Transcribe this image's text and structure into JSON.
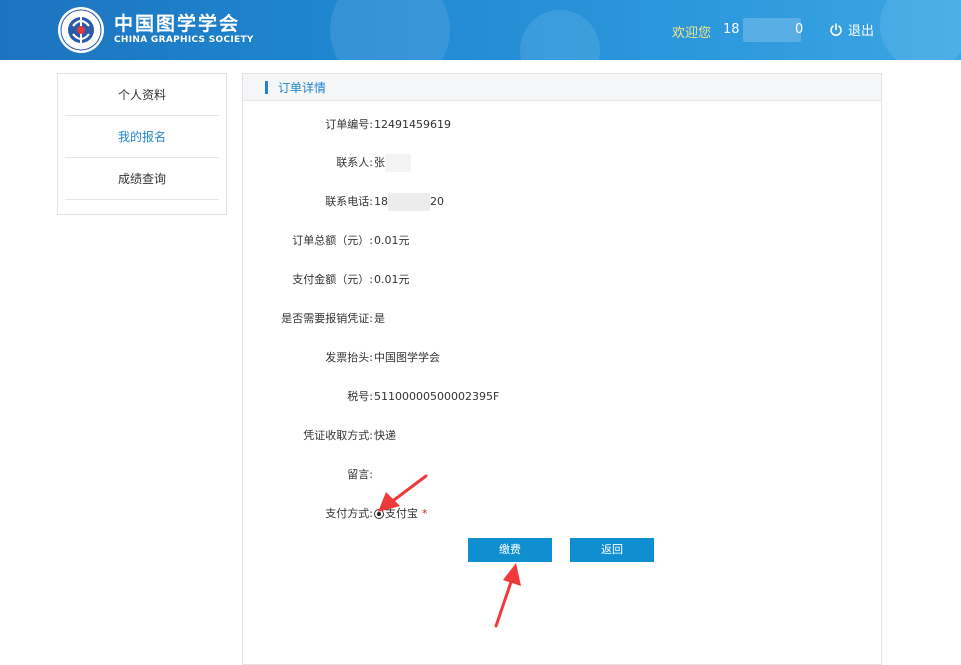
{
  "header": {
    "logo_cn": "中国图学学会",
    "logo_en": "CHINA GRAPHICS SOCIETY",
    "welcome": "欢迎您",
    "username_start": "18",
    "username_end": "0",
    "logout": "退出"
  },
  "sidebar": {
    "items": [
      {
        "label": "个人资料"
      },
      {
        "label": "我的报名"
      },
      {
        "label": "成绩查询"
      }
    ]
  },
  "main": {
    "title": "订单详情",
    "fields": {
      "order_no": {
        "label": "订单编号:",
        "value": "12491459619"
      },
      "contact": {
        "label": "联系人:",
        "value": "张"
      },
      "phone": {
        "label": "联系电话:",
        "value_start": "18",
        "value_end": "20"
      },
      "total": {
        "label": "订单总额（元）:",
        "value": "0.01元"
      },
      "paid": {
        "label": "支付金额（元）:",
        "value": "0.01元"
      },
      "invoice_needed": {
        "label": "是否需要报销凭证:",
        "value": "是"
      },
      "invoice_title": {
        "label": "发票抬头:",
        "value": "中国图学学会"
      },
      "tax_no": {
        "label": "税号:",
        "value": "51100000500002395F"
      },
      "delivery": {
        "label": "凭证收取方式:",
        "value": "快递"
      },
      "message": {
        "label": "留言:",
        "value": ""
      },
      "payment": {
        "label": "支付方式:",
        "option": "支付宝",
        "required_mark": "*"
      }
    },
    "buttons": {
      "pay": "缴费",
      "back": "返回"
    }
  },
  "colors": {
    "accent": "#1f86c8",
    "button": "#0f8fcf",
    "annotation_arrow": "#f03a3a",
    "welcome_text": "#f5e58a"
  }
}
